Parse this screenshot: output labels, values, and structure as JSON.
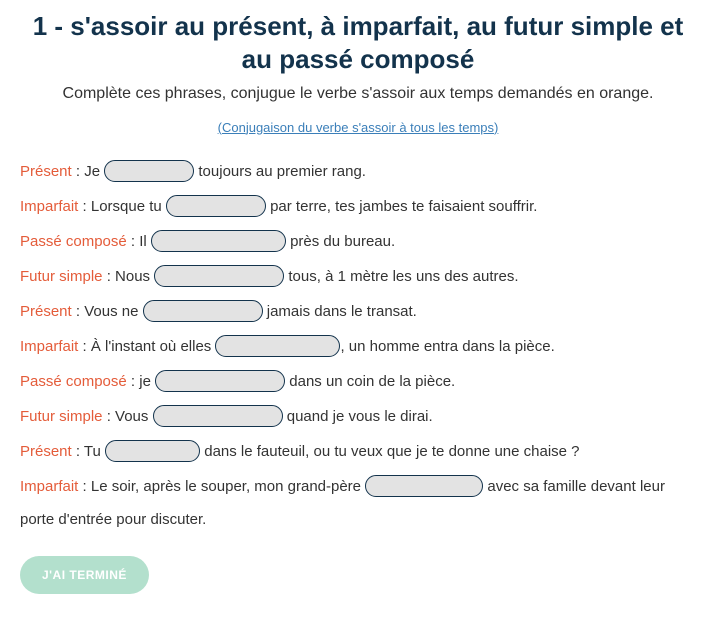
{
  "header": {
    "title": "1 - s'assoir au présent, à imparfait, au futur simple et au passé composé",
    "subtitle": "Complète ces phrases, conjugue le verbe s'assoir aux temps demandés en orange.",
    "link_text": "(Conjugaison du verbe s'assoir à tous les temps)"
  },
  "sentences": [
    {
      "tense": "Présent",
      "before": " : Je ",
      "after": " toujours au premier rang.",
      "width": "w90"
    },
    {
      "tense": "Imparfait",
      "before": " : Lorsque tu ",
      "after": " par terre, tes jambes te faisaient souffrir.",
      "width": "w100"
    },
    {
      "tense": "Passé composé",
      "before": " : Il ",
      "after": " près du bureau.",
      "width": "w135"
    },
    {
      "tense": "Futur simple",
      "before": " : Nous ",
      "after": " tous, à 1 mètre les uns des autres.",
      "width": "w130"
    },
    {
      "tense": "Présent",
      "before": " : Vous ne ",
      "after": " jamais dans le transat.",
      "width": "w120"
    },
    {
      "tense": "Imparfait",
      "before": " : À l'instant où elles ",
      "after": ", un homme entra dans la pièce.",
      "width": "w125"
    },
    {
      "tense": "Passé composé",
      "before": " : je ",
      "after": " dans un coin de la pièce.",
      "width": "w130"
    },
    {
      "tense": "Futur simple",
      "before": " : Vous ",
      "after": " quand je vous le dirai.",
      "width": "w130"
    },
    {
      "tense": "Présent",
      "before": " : Tu ",
      "after": " dans le fauteuil, ou tu veux que je te donne une chaise ?",
      "width": "w95"
    },
    {
      "tense": "Imparfait",
      "before": " : Le soir, après le souper, mon grand-père ",
      "after": " avec sa famille devant leur porte d'entrée pour discuter.",
      "width": "w118"
    }
  ],
  "button": {
    "done_label": "J'AI TERMINÉ"
  }
}
